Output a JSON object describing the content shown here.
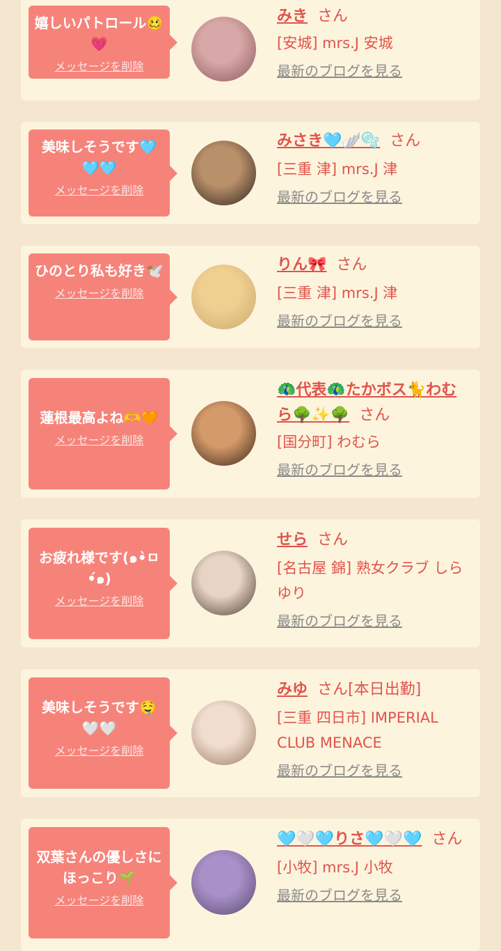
{
  "delete_label": "メッセージを削除",
  "san_label": "さん",
  "blog_label": "最新のブログを見る",
  "colors": {
    "page_bg": "#f5e6cf",
    "card_bg": "#fdf4de",
    "bubble_bg": "#f6837a",
    "accent_text": "#e0534b",
    "link_gray": "#8a8a8a"
  },
  "items": [
    {
      "message": "嬉しいパトロール🥴💗",
      "name": "みき",
      "status": "",
      "shop": "[安城] mrs.J 安城",
      "avatar_colors": [
        "#d8a8a8",
        "#8a5858"
      ]
    },
    {
      "message": "美味しそうです🩵🩵🩵",
      "name": "みさき🩵🪽🫧",
      "status": "",
      "shop": "[三重 津] mrs.J 津",
      "avatar_colors": [
        "#b8906a",
        "#2e231c"
      ]
    },
    {
      "message": "ひのとり私も好き🕊️",
      "name": "りん🎀",
      "status": "",
      "shop": "[三重 津] mrs.J 津",
      "avatar_colors": [
        "#f0d090",
        "#c8a870"
      ]
    },
    {
      "message": "蓮根最高よね🫶🧡",
      "name": "🦚代表🦚たかボス🐈わむら🌳✨🌳",
      "status": "",
      "shop": "[国分町] わむら",
      "avatar_colors": [
        "#d49a6a",
        "#3a2414"
      ]
    },
    {
      "message": "お疲れ様です(๑•̀ㅁ•́๑)",
      "name": "せら",
      "status": "",
      "shop": "[名古屋 錦] 熟女クラブ しらゆり",
      "avatar_colors": [
        "#e8d4c4",
        "#4a3a30"
      ]
    },
    {
      "message": "美味しそうです🤤🤍🤍",
      "name": "みゆ",
      "status": "[本日出勤]",
      "shop": "[三重 四日市] IMPERIAL CLUB MENACE",
      "avatar_colors": [
        "#f0ddd0",
        "#9a7a60"
      ]
    },
    {
      "message": "双葉さんの優しさにほっこり🌱",
      "name": "🩵🤍🩵りさ🩵🤍🩵",
      "status": "",
      "shop": "[小牧] mrs.J 小牧",
      "avatar_colors": [
        "#a890c8",
        "#5a4a70"
      ]
    }
  ]
}
